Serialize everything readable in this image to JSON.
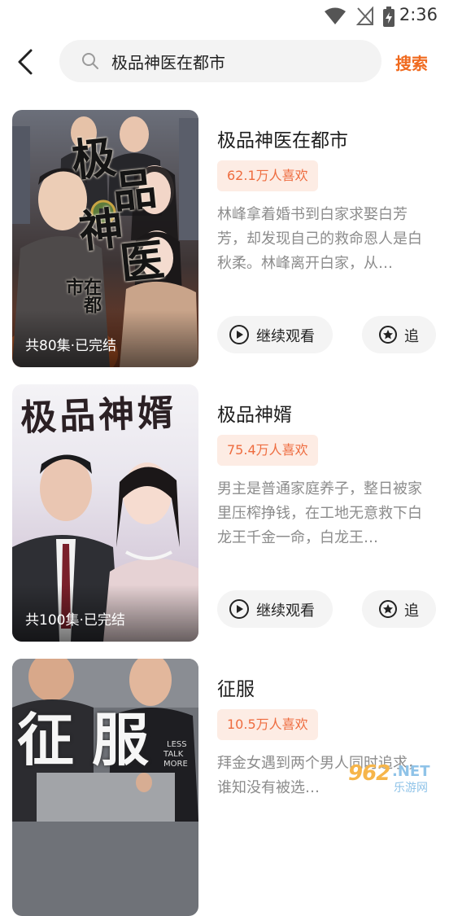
{
  "status_bar": {
    "time": "2:36",
    "icons": [
      "wifi-icon",
      "no-signal-icon",
      "battery-charging-icon"
    ]
  },
  "header": {
    "back_icon": "chevron-left-icon",
    "search_icon": "search-icon",
    "search_query": "极品神医在都市",
    "search_button": "搜索",
    "accent_color": "#f06a1e"
  },
  "results": [
    {
      "title": "极品神医在都市",
      "likes": "62.1万人喜欢",
      "description": "林峰拿着婚书到白家求娶白芳芳，却发现自己的救命恩人是白秋柔。林峰离开白家，从…",
      "episodes": "共80集·已完结",
      "poster_title": "极品神医",
      "poster_subtitle": "在都市",
      "watch_label": "继续观看",
      "follow_label": "追"
    },
    {
      "title": "极品神婿",
      "likes": "75.4万人喜欢",
      "description": "男主是普通家庭养子，整日被家里压榨挣钱，在工地无意救下白龙王千金一命，白龙王…",
      "episodes": "共100集·已完结",
      "poster_title": "极品神婿",
      "watch_label": "继续观看",
      "follow_label": "追"
    },
    {
      "title": "征服",
      "likes": "10.5万人喜欢",
      "description": "拜金女遇到两个男人同时追求，谁知没有被选…",
      "poster_title": "征服",
      "poster_shirt_text": "LESS TALK MORE"
    }
  ],
  "watermark": {
    "number": "962",
    "suffix": ".NET",
    "text": "乐游网"
  }
}
